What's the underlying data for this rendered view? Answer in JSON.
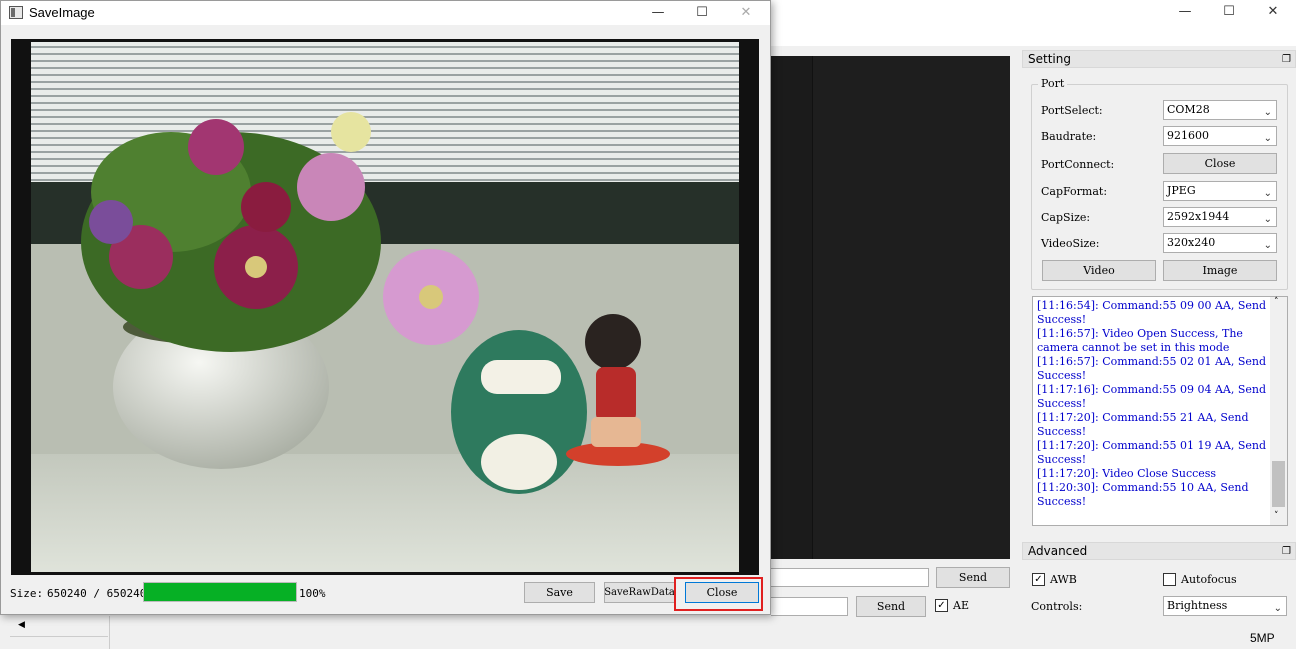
{
  "dialog": {
    "title": "SaveImage",
    "size_label": "Size:",
    "size_value": "650240 / 650240",
    "progress_fraction": 1.0,
    "progress_text": "100%",
    "buttons": {
      "save": "Save",
      "save_raw": "SaveRawData",
      "close": "Close"
    }
  },
  "setting": {
    "title": "Setting",
    "port_group": "Port",
    "rows": {
      "port_select": {
        "label": "PortSelect:",
        "value": "COM28"
      },
      "baudrate": {
        "label": "Baudrate:",
        "value": "921600"
      },
      "port_connect": {
        "label": "PortConnect:",
        "button": "Close"
      },
      "cap_format": {
        "label": "CapFormat:",
        "value": "JPEG"
      },
      "cap_size": {
        "label": "CapSize:",
        "value": "2592x1944"
      },
      "video_size": {
        "label": "VideoSize:",
        "value": "320x240"
      }
    },
    "video_button": "Video",
    "image_button": "Image"
  },
  "log": [
    "[11:16:54]: Command:55 09 00 AA, Send",
    "Success!",
    "[11:16:57]: Video Open Success, The",
    "camera cannot be set in this mode",
    "[11:16:57]: Command:55 02 01 AA, Send",
    "Success!",
    "[11:17:16]: Command:55 09 04 AA, Send",
    "Success!",
    "[11:17:20]: Command:55 21 AA, Send",
    "Success!",
    "[11:17:20]: Command:55 01 19 AA, Send",
    "Success!",
    "[11:17:20]: Video Close Success",
    "[11:20:30]: Command:55 10 AA, Send",
    "Success!"
  ],
  "advanced": {
    "title": "Advanced",
    "awb_label": "AWB",
    "awb_checked": true,
    "autofocus_label": "Autofocus",
    "autofocus_checked": false,
    "controls_label": "Controls:",
    "controls_value": "Brightness",
    "ae_label": "AE",
    "ae_checked": true
  },
  "send_buttons": {
    "send1": "Send",
    "send2": "Send"
  },
  "status": {
    "resolution": "5MP"
  },
  "colors": {
    "progress": "#06b025",
    "log_text": "#0000cc",
    "highlight": "#e02020"
  }
}
